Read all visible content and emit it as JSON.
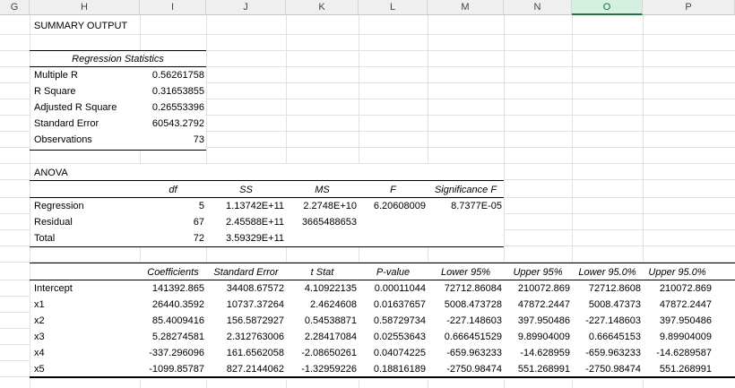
{
  "columns": [
    "G",
    "H",
    "I",
    "J",
    "K",
    "L",
    "M",
    "N",
    "O",
    "P"
  ],
  "selected_column": "O",
  "summary_title": "SUMMARY OUTPUT",
  "regression_statistics": {
    "title": "Regression Statistics",
    "rows": [
      {
        "label": "Multiple R",
        "value": "0.56261758"
      },
      {
        "label": "R Square",
        "value": "0.31653855"
      },
      {
        "label": "Adjusted R Square",
        "value": "0.26553396"
      },
      {
        "label": "Standard Error",
        "value": "60543.2792"
      },
      {
        "label": "Observations",
        "value": "73"
      }
    ]
  },
  "anova": {
    "title": "ANOVA",
    "headers": [
      "df",
      "SS",
      "MS",
      "F",
      "Significance F"
    ],
    "rows": [
      {
        "label": "Regression",
        "df": "5",
        "ss": "1.13742E+11",
        "ms": "2.2748E+10",
        "f": "6.20608009",
        "sig": "8.7377E-05"
      },
      {
        "label": "Residual",
        "df": "67",
        "ss": "2.45588E+11",
        "ms": "3665488653",
        "f": "",
        "sig": ""
      },
      {
        "label": "Total",
        "df": "72",
        "ss": "3.59329E+11",
        "ms": "",
        "f": "",
        "sig": ""
      }
    ]
  },
  "coefficients": {
    "headers": [
      "Coefficients",
      "Standard Error",
      "t Stat",
      "P-value",
      "Lower 95%",
      "Upper 95%",
      "Lower 95.0%",
      "Upper 95.0%"
    ],
    "rows": [
      {
        "label": "Intercept",
        "vals": [
          "141392.865",
          "34408.67572",
          "4.10922135",
          "0.00011044",
          "72712.86084",
          "210072.869",
          "72712.8608",
          "210072.869"
        ]
      },
      {
        "label": "x1",
        "vals": [
          "26440.3592",
          "10737.37264",
          "2.4624608",
          "0.01637657",
          "5008.473728",
          "47872.2447",
          "5008.47373",
          "47872.2447"
        ]
      },
      {
        "label": "x2",
        "vals": [
          "85.4009416",
          "156.5872927",
          "0.54538871",
          "0.58729734",
          "-227.148603",
          "397.950486",
          "-227.148603",
          "397.950486"
        ]
      },
      {
        "label": "x3",
        "vals": [
          "5.28274581",
          "2.312763006",
          "2.28417084",
          "0.02553643",
          "0.666451529",
          "9.89904009",
          "0.66645153",
          "9.89904009"
        ]
      },
      {
        "label": "x4",
        "vals": [
          "-337.296096",
          "161.6562058",
          "-2.08650261",
          "0.04074225",
          "-659.963233",
          "-14.628959",
          "-659.963233",
          "-14.6289587"
        ]
      },
      {
        "label": "x5",
        "vals": [
          "-1099.85787",
          "827.2144062",
          "-1.32959226",
          "0.18816189",
          "-2750.98474",
          "551.268991",
          "-2750.98474",
          "551.268991"
        ]
      }
    ]
  },
  "colors": {
    "header_bg": "#efefef",
    "selected_header_bg": "#d3f0e0",
    "selected_accent": "#217346",
    "gridline": "#e1e1e1"
  }
}
